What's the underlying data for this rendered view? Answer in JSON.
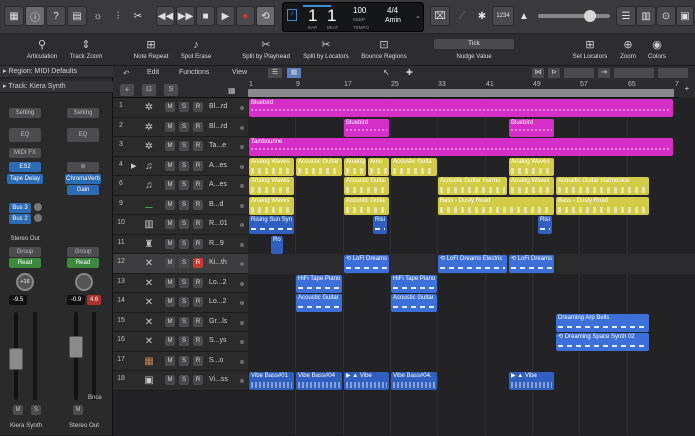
{
  "lcd": {
    "bar": "1",
    "beat": "1",
    "bar_label": "BAR",
    "beat_label": "BEAT",
    "tempo": "100",
    "tempo_keep": "KEEP",
    "tempo_label": "TEMPO",
    "signature": "4/4",
    "key": "Amin"
  },
  "toolbar": {
    "counter": "1234"
  },
  "toolbar2": [
    {
      "icon": "articulation-icon",
      "label": "Articulation"
    },
    {
      "icon": "track-zoom-icon",
      "label": "Track Zoom"
    },
    {
      "icon": "note-repeat-icon",
      "label": "Note Repeat"
    },
    {
      "icon": "spot-erase-icon",
      "label": "Spot Erase"
    },
    {
      "icon": "split-playhead-icon",
      "label": "Split by Playhead"
    },
    {
      "icon": "split-locators-icon",
      "label": "Split by Locators"
    },
    {
      "icon": "bounce-regions-icon",
      "label": "Bounce Regions"
    },
    {
      "icon": "nudge-icon",
      "label": "Nudge Value",
      "value": "Tick"
    },
    {
      "icon": "set-locators-icon",
      "label": "Set Locators"
    },
    {
      "icon": "zoom-icon",
      "label": "Zoom"
    },
    {
      "icon": "colors-icon",
      "label": "Colors"
    }
  ],
  "inspector": {
    "region": "Region: MIDI Defaults",
    "track": "Track:  Kiera Synth",
    "setting": "Setting",
    "eq": "EQ",
    "midi_fx": "MIDI FX",
    "plugin": "ES2",
    "tape_delay": "Tape Delay",
    "bus3": "Bus 3",
    "bus2": "Bus 2",
    "stereo_out": "Stereo Out",
    "group": "Group",
    "read": "Read",
    "pan1": "+16",
    "vol1": "-9.5",
    "vol2": "-0.9",
    "peak2": "4.6",
    "ch2_plugin": "ChromaVerb",
    "ch2_gain": "Gain",
    "ch1_name": "Kiera Synth",
    "ch2_name": "Stereo Out",
    "bnce": "Bnce",
    "m": "M",
    "s": "S"
  },
  "menus": {
    "edit": "Edit",
    "functions": "Functions",
    "view": "View"
  },
  "ruler": [
    "1",
    "9",
    "17",
    "25",
    "33",
    "41",
    "49",
    "57",
    "65",
    "73"
  ],
  "tracks": [
    {
      "num": "1",
      "name": "Bl...rd",
      "icon": "drum-icon"
    },
    {
      "num": "2",
      "name": "Bl...rd",
      "icon": "drum-icon"
    },
    {
      "num": "3",
      "name": "Ta...e",
      "icon": "drum-icon"
    },
    {
      "num": "4",
      "name": "A...es",
      "icon": "guitar-icon"
    },
    {
      "num": "6",
      "name": "A...es",
      "icon": "guitar-icon"
    },
    {
      "num": "9",
      "name": "B...d",
      "icon": "bass-icon"
    },
    {
      "num": "10",
      "name": "R...01",
      "icon": "keys-icon"
    },
    {
      "num": "11",
      "name": "R...9",
      "icon": "piano-icon"
    },
    {
      "num": "12",
      "name": "Ki...th",
      "icon": "synth-icon"
    },
    {
      "num": "13",
      "name": "Lo...2",
      "icon": "synth-icon"
    },
    {
      "num": "14",
      "name": "Lo...2",
      "icon": "synth-icon"
    },
    {
      "num": "15",
      "name": "Gr...ls",
      "icon": "synth-icon"
    },
    {
      "num": "16",
      "name": "S...ys",
      "icon": "synth-icon"
    },
    {
      "num": "17",
      "name": "S...o",
      "icon": "synth-icon"
    },
    {
      "num": "18",
      "name": "Vi...ss",
      "icon": "amp-icon"
    }
  ],
  "regions": {
    "r0": [
      "Bluebird"
    ],
    "r1": [
      "Bluebird",
      "Bluebird"
    ],
    "r2": [
      "Tambourine"
    ],
    "r3": [
      "Analog Waves",
      "Acoustic Guitar",
      "Analog",
      "Acoustic Guita",
      "Analog Waves"
    ],
    "r4": [
      "Analog Waves",
      "Acoustic Guita",
      "Acoustic Guitar Harmo",
      "Analog Waves",
      "Acoustic Guitar Harmonice"
    ],
    "r5": [
      "Analog Waves",
      "Acoustic Guita",
      "Bass - Dusty Road",
      "Bass - Dusty Road"
    ],
    "r6": [
      "Rising Sun Syn",
      "Risi",
      "Risi"
    ],
    "r7": [
      "Ro"
    ],
    "r8": [
      "LoFi Dreams",
      "LoFi Dreams Electric",
      "LoFi Dreams"
    ],
    "r9": [
      "HiFi Tape Piano",
      "HiFi Tape Piano"
    ],
    "r10": [
      "Acoustic Guitar",
      "Acoustic Guitar"
    ],
    "r11": [
      "Dreaming Arp Bells"
    ],
    "r12": [
      "Dreaming Space Synth 02"
    ],
    "r14": [
      "Vibe Bass#01",
      "Vibe Bass#04",
      "Vibe",
      "Vibe Bass#04.",
      "Vibe"
    ]
  }
}
